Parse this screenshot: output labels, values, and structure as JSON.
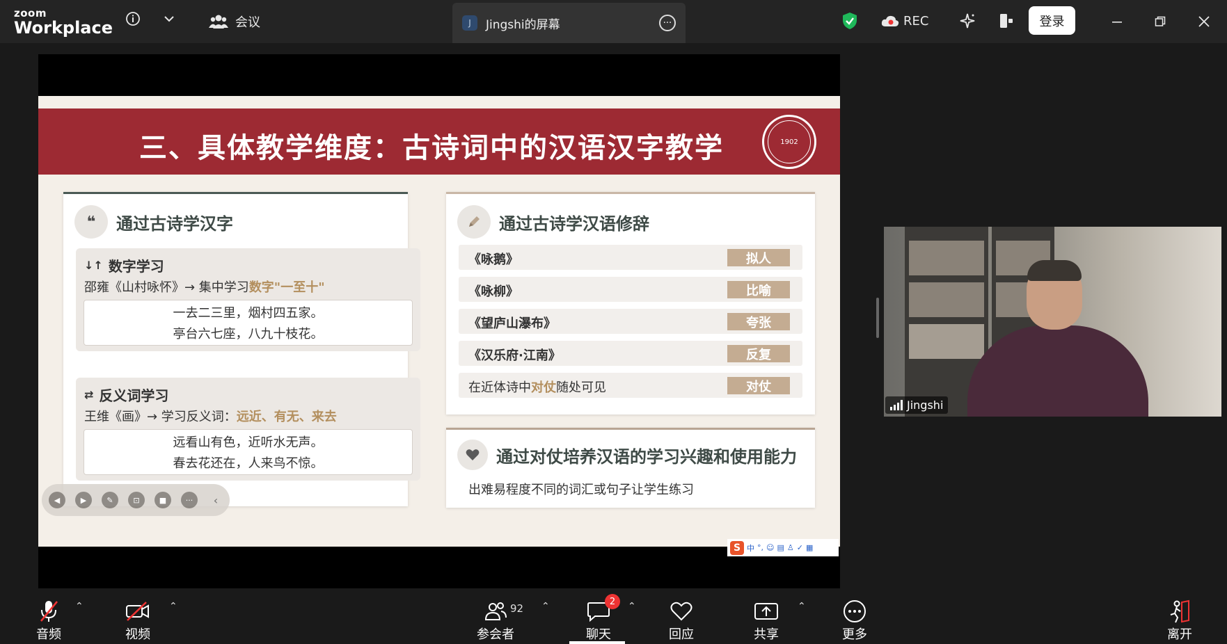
{
  "titlebar": {
    "logo_top": "zoom",
    "logo_bottom": "Workplace",
    "meeting_label": "会议",
    "share_avatar_letter": "J",
    "share_tab_title": "Jingshi的屏幕",
    "rec_label": "REC",
    "login_label": "登录"
  },
  "slide": {
    "title": "三、具体教学维度：古诗词中的汉语汉字教学",
    "seal_text": "1902",
    "left_card": {
      "heading": "通过古诗学汉字",
      "section1": {
        "title": "数字学习",
        "line_prefix": "邵雍《山村咏怀》→ 集中学习",
        "line_highlight": "数字\"一至十\"",
        "poem_line1": "一去二三里，烟村四五家。",
        "poem_line2": "亭台六七座，八九十枝花。"
      },
      "section2": {
        "title": "反义词学习",
        "line_prefix": "王维《画》→ 学习反义词：",
        "line_highlight": "远近、有无、来去",
        "poem_line1": "远看山有色，近听水无声。",
        "poem_line2": "春去花还在，人来鸟不惊。"
      }
    },
    "right_card1": {
      "heading": "通过古诗学汉语修辞",
      "rows": [
        {
          "label": "《咏鹅》",
          "tag": "拟人"
        },
        {
          "label": "《咏柳》",
          "tag": "比喻"
        },
        {
          "label": "《望庐山瀑布》",
          "tag": "夸张"
        },
        {
          "label": "《汉乐府·江南》",
          "tag": "反复"
        }
      ],
      "last_row": {
        "prefix": "在近体诗中",
        "highlight": "对仗",
        "suffix": "随处可见",
        "tag": "对仗"
      }
    },
    "right_card2": {
      "heading": "通过对仗培养汉语的学习兴趣和使用能力",
      "text": "出难易程度不同的词汇或句子让学生练习"
    },
    "ime": {
      "logo": "S",
      "lang": "中"
    }
  },
  "video": {
    "name": "Jingshi"
  },
  "bottombar": {
    "audio": "音频",
    "video": "视频",
    "participants": "参会者",
    "participant_count": "92",
    "chat": "聊天",
    "chat_badge": "2",
    "react": "回应",
    "share": "共享",
    "more": "更多",
    "leave": "离开"
  },
  "colors": {
    "header_red": "#9d2a33",
    "tag_tan": "#c4ac92",
    "highlight": "#b38f5e",
    "shield_green": "#1fb85a",
    "leave_red": "#e33"
  }
}
